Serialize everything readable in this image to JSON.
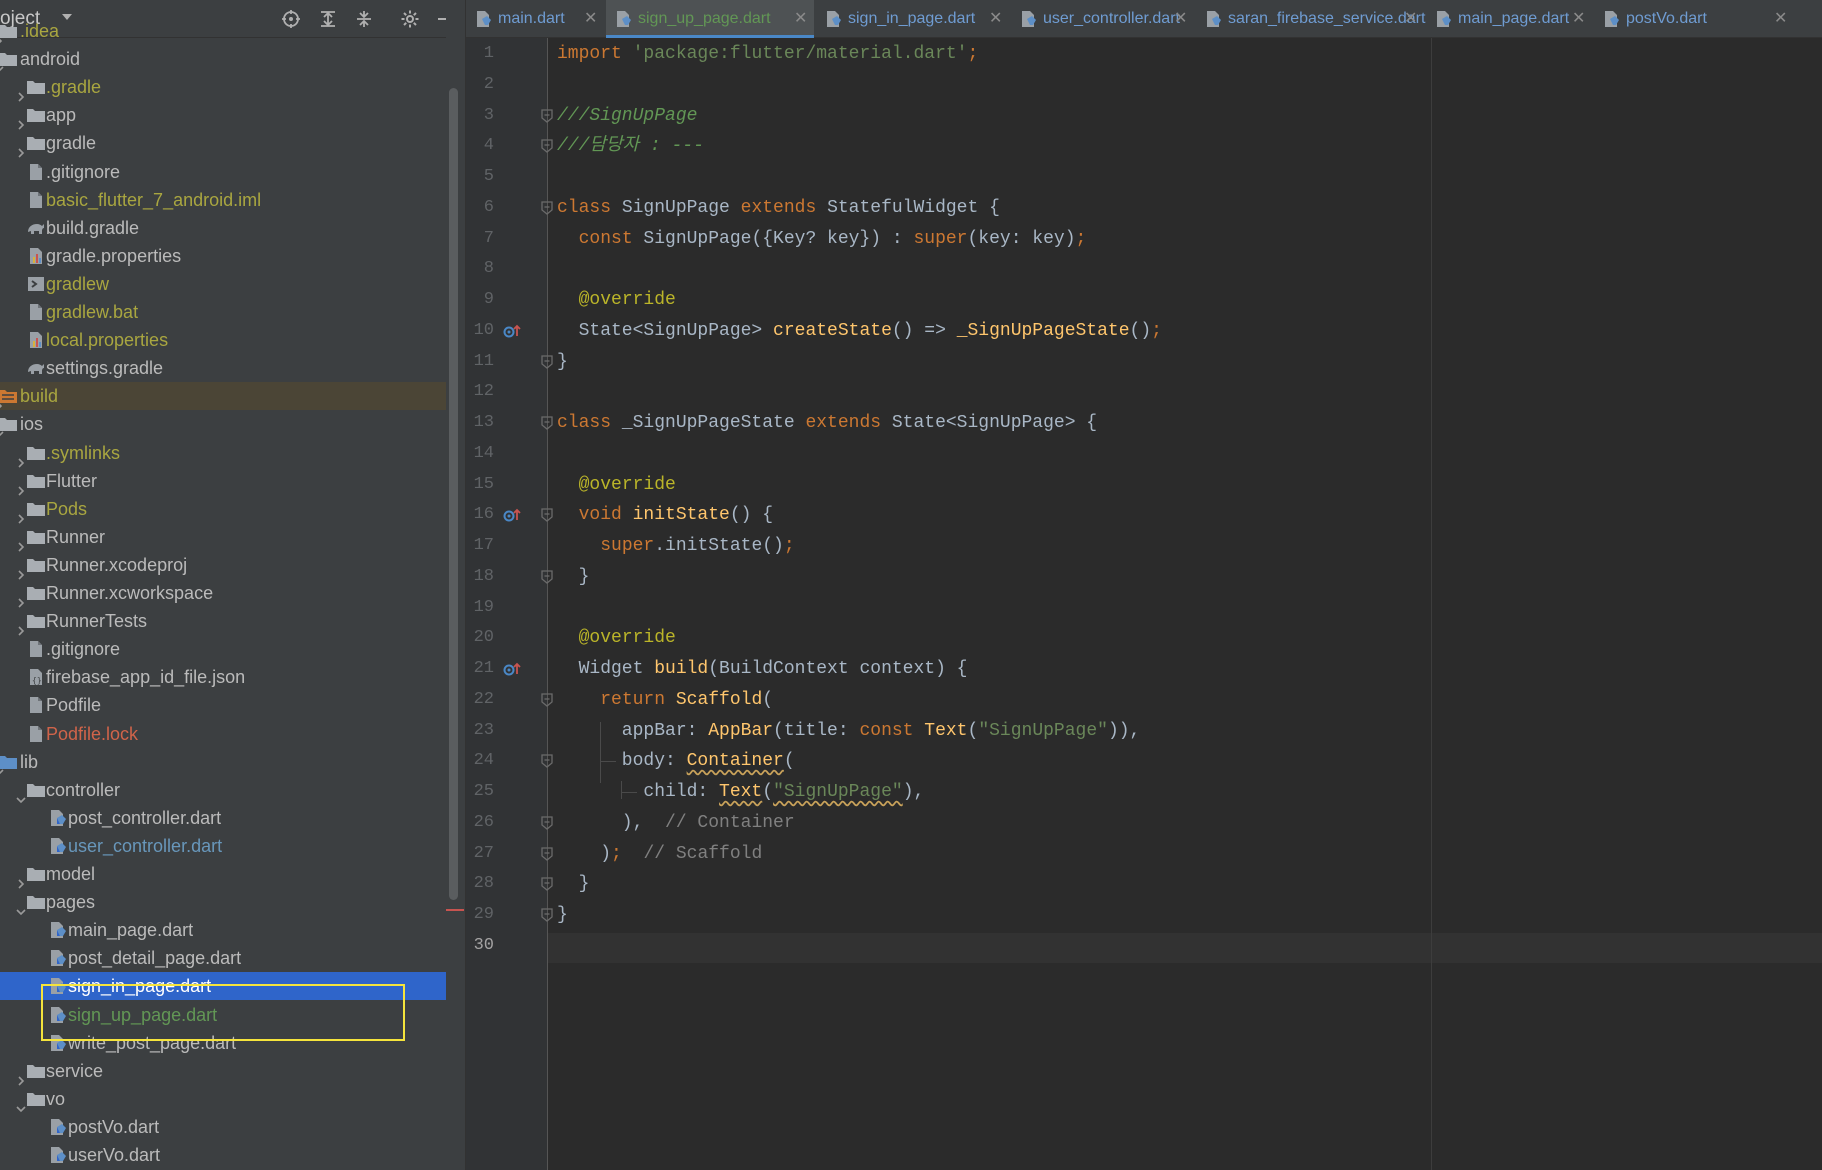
{
  "panel": {
    "title": "oject",
    "tree": [
      {
        "label": ".idea",
        "depth": 0,
        "type": "folder",
        "color": "ignored",
        "expanded": false
      },
      {
        "label": "android",
        "depth": 0,
        "type": "folder",
        "color": "default",
        "expanded": true
      },
      {
        "label": ".gradle",
        "depth": 1,
        "type": "folder",
        "color": "ignored",
        "expanded": false
      },
      {
        "label": "app",
        "depth": 1,
        "type": "folder",
        "color": "default",
        "expanded": false
      },
      {
        "label": "gradle",
        "depth": 1,
        "type": "folder",
        "color": "default",
        "expanded": false
      },
      {
        "label": ".gitignore",
        "depth": 1,
        "type": "file",
        "color": "default"
      },
      {
        "label": "basic_flutter_7_android.iml",
        "depth": 1,
        "type": "file",
        "color": "ignored"
      },
      {
        "label": "build.gradle",
        "depth": 1,
        "type": "gradle",
        "color": "default"
      },
      {
        "label": "gradle.properties",
        "depth": 1,
        "type": "props",
        "color": "default"
      },
      {
        "label": "gradlew",
        "depth": 1,
        "type": "exec",
        "color": "ignored"
      },
      {
        "label": "gradlew.bat",
        "depth": 1,
        "type": "file",
        "color": "ignored"
      },
      {
        "label": "local.properties",
        "depth": 1,
        "type": "props",
        "color": "ignored"
      },
      {
        "label": "settings.gradle",
        "depth": 1,
        "type": "gradle",
        "color": "default"
      },
      {
        "label": "build",
        "depth": 0,
        "type": "folder-excluded",
        "color": "ignored",
        "expanded": false,
        "dim": true
      },
      {
        "label": "ios",
        "depth": 0,
        "type": "folder",
        "color": "default",
        "expanded": true
      },
      {
        "label": ".symlinks",
        "depth": 1,
        "type": "folder",
        "color": "ignored",
        "expanded": false
      },
      {
        "label": "Flutter",
        "depth": 1,
        "type": "folder",
        "color": "default",
        "expanded": false
      },
      {
        "label": "Pods",
        "depth": 1,
        "type": "folder",
        "color": "ignored",
        "expanded": false
      },
      {
        "label": "Runner",
        "depth": 1,
        "type": "folder",
        "color": "default",
        "expanded": false
      },
      {
        "label": "Runner.xcodeproj",
        "depth": 1,
        "type": "folder",
        "color": "default",
        "expanded": false
      },
      {
        "label": "Runner.xcworkspace",
        "depth": 1,
        "type": "folder",
        "color": "default",
        "expanded": false
      },
      {
        "label": "RunnerTests",
        "depth": 1,
        "type": "folder",
        "color": "default",
        "expanded": false
      },
      {
        "label": ".gitignore",
        "depth": 1,
        "type": "file",
        "color": "default"
      },
      {
        "label": "firebase_app_id_file.json",
        "depth": 1,
        "type": "json",
        "color": "default"
      },
      {
        "label": "Podfile",
        "depth": 1,
        "type": "file",
        "color": "default"
      },
      {
        "label": "Podfile.lock",
        "depth": 1,
        "type": "file",
        "color": "excluded"
      },
      {
        "label": "lib",
        "depth": 0,
        "type": "folder-src",
        "color": "default",
        "expanded": true
      },
      {
        "label": "controller",
        "depth": 1,
        "type": "folder",
        "color": "default",
        "expanded": true
      },
      {
        "label": "post_controller.dart",
        "depth": 2,
        "type": "dart",
        "color": "default"
      },
      {
        "label": "user_controller.dart",
        "depth": 2,
        "type": "dart",
        "color": "modified"
      },
      {
        "label": "model",
        "depth": 1,
        "type": "folder",
        "color": "default",
        "expanded": false
      },
      {
        "label": "pages",
        "depth": 1,
        "type": "folder",
        "color": "default",
        "expanded": true
      },
      {
        "label": "main_page.dart",
        "depth": 2,
        "type": "dart",
        "color": "default"
      },
      {
        "label": "post_detail_page.dart",
        "depth": 2,
        "type": "dart",
        "color": "default"
      },
      {
        "label": "sign_in_page.dart",
        "depth": 2,
        "type": "dart",
        "color": "default",
        "selected": true
      },
      {
        "label": "sign_up_page.dart",
        "depth": 2,
        "type": "dart",
        "color": "added"
      },
      {
        "label": "write_post_page.dart",
        "depth": 2,
        "type": "dart",
        "color": "default"
      },
      {
        "label": "service",
        "depth": 1,
        "type": "folder",
        "color": "default",
        "expanded": false
      },
      {
        "label": "vo",
        "depth": 1,
        "type": "folder",
        "color": "default",
        "expanded": true
      },
      {
        "label": "postVo.dart",
        "depth": 2,
        "type": "dart",
        "color": "default"
      },
      {
        "label": "userVo.dart",
        "depth": 2,
        "type": "dart",
        "color": "default"
      }
    ]
  },
  "tabs": [
    {
      "label": "main.dart",
      "active": false
    },
    {
      "label": "sign_up_page.dart",
      "active": true
    },
    {
      "label": "sign_in_page.dart",
      "active": false
    },
    {
      "label": "user_controller.dart",
      "active": false
    },
    {
      "label": "saran_firebase_service.dart",
      "active": false
    },
    {
      "label": "main_page.dart",
      "active": false
    },
    {
      "label": "postVo.dart",
      "active": false
    }
  ],
  "editor": {
    "current_line": "30",
    "lines": [
      {
        "n": "1",
        "tokens": [
          [
            "kw",
            "import "
          ],
          [
            "str",
            "'package:flutter/material.dart'"
          ],
          [
            "kw",
            ";"
          ]
        ]
      },
      {
        "n": "2",
        "tokens": []
      },
      {
        "n": "3",
        "tokens": [
          [
            "cm",
            "///SignUpPage"
          ]
        ]
      },
      {
        "n": "4",
        "tokens": [
          [
            "cm",
            "///담당자 : ---"
          ]
        ]
      },
      {
        "n": "5",
        "tokens": []
      },
      {
        "n": "6",
        "tokens": [
          [
            "kw",
            "class "
          ],
          [
            "p",
            "SignUpPage "
          ],
          [
            "kw",
            "extends "
          ],
          [
            "p",
            "StatefulWidget {"
          ]
        ]
      },
      {
        "n": "7",
        "tokens": [
          [
            "p",
            "  "
          ],
          [
            "kw",
            "const "
          ],
          [
            "p",
            "SignUpPage({Key? key}) : "
          ],
          [
            "kw",
            "super"
          ],
          [
            "p",
            "(key: key)"
          ],
          [
            "kw",
            ";"
          ]
        ]
      },
      {
        "n": "8",
        "tokens": []
      },
      {
        "n": "9",
        "tokens": [
          [
            "p",
            "  "
          ],
          [
            "ann",
            "@override"
          ]
        ]
      },
      {
        "n": "10",
        "tokens": [
          [
            "p",
            "  State<SignUpPage> "
          ],
          [
            "fn",
            "createState"
          ],
          [
            "p",
            "() => "
          ],
          [
            "fn",
            "_SignUpPageState"
          ],
          [
            "p",
            "()"
          ],
          [
            "kw",
            ";"
          ]
        ]
      },
      {
        "n": "11",
        "tokens": [
          [
            "p",
            "}"
          ]
        ]
      },
      {
        "n": "12",
        "tokens": []
      },
      {
        "n": "13",
        "tokens": [
          [
            "kw",
            "class "
          ],
          [
            "p",
            "_SignUpPageState "
          ],
          [
            "kw",
            "extends "
          ],
          [
            "p",
            "State<SignUpPage> {"
          ]
        ]
      },
      {
        "n": "14",
        "tokens": []
      },
      {
        "n": "15",
        "tokens": [
          [
            "p",
            "  "
          ],
          [
            "ann",
            "@override"
          ]
        ]
      },
      {
        "n": "16",
        "tokens": [
          [
            "p",
            "  "
          ],
          [
            "kw",
            "void "
          ],
          [
            "fn",
            "initState"
          ],
          [
            "p",
            "() {"
          ]
        ]
      },
      {
        "n": "17",
        "tokens": [
          [
            "p",
            "    "
          ],
          [
            "kw",
            "super"
          ],
          [
            "p",
            ".initState()"
          ],
          [
            "kw",
            ";"
          ]
        ]
      },
      {
        "n": "18",
        "tokens": [
          [
            "p",
            "  }"
          ]
        ]
      },
      {
        "n": "19",
        "tokens": []
      },
      {
        "n": "20",
        "tokens": [
          [
            "p",
            "  "
          ],
          [
            "ann",
            "@override"
          ]
        ]
      },
      {
        "n": "21",
        "tokens": [
          [
            "p",
            "  Widget "
          ],
          [
            "fn",
            "build"
          ],
          [
            "p",
            "(BuildContext context) {"
          ]
        ]
      },
      {
        "n": "22",
        "tokens": [
          [
            "p",
            "    "
          ],
          [
            "kw",
            "return "
          ],
          [
            "fn",
            "Scaffold"
          ],
          [
            "p",
            "("
          ]
        ]
      },
      {
        "n": "23",
        "tokens": [
          [
            "p",
            "      appBar: "
          ],
          [
            "fn",
            "AppBar"
          ],
          [
            "p",
            "(title: "
          ],
          [
            "kw",
            "const "
          ],
          [
            "fn",
            "Text"
          ],
          [
            "p",
            "("
          ],
          [
            "str",
            "\"SignUpPage\""
          ],
          [
            "p",
            ")),"
          ]
        ]
      },
      {
        "n": "24",
        "tokens": [
          [
            "p",
            "      body: "
          ],
          [
            "fnsq",
            "Container"
          ],
          [
            "p",
            "("
          ]
        ]
      },
      {
        "n": "25",
        "tokens": [
          [
            "p",
            "        child: "
          ],
          [
            "fnsq",
            "Text"
          ],
          [
            "p",
            "("
          ],
          [
            "strsq",
            "\"SignUpPage\""
          ],
          [
            "p",
            "),"
          ]
        ]
      },
      {
        "n": "26",
        "tokens": [
          [
            "p",
            "      ),  "
          ],
          [
            "gray",
            "// Container"
          ]
        ]
      },
      {
        "n": "27",
        "tokens": [
          [
            "p",
            "    )"
          ],
          [
            "kw",
            ";"
          ],
          [
            "p",
            "  "
          ],
          [
            "gray",
            "// Scaffold"
          ]
        ]
      },
      {
        "n": "28",
        "tokens": [
          [
            "p",
            "  }"
          ]
        ]
      },
      {
        "n": "29",
        "tokens": [
          [
            "p",
            "}"
          ]
        ]
      },
      {
        "n": "30",
        "tokens": []
      }
    ],
    "override_lines": [
      "10",
      "16",
      "21"
    ],
    "fold_lines": [
      "3",
      "4",
      "6",
      "11",
      "13",
      "16",
      "18",
      "22",
      "24",
      "26",
      "27",
      "28",
      "29"
    ]
  },
  "colors": {
    "panel_bg": "#3c3f41",
    "editor_bg": "#2b2b2b",
    "selection": "#2f65ca",
    "highlight_box": "#f5e43c"
  }
}
